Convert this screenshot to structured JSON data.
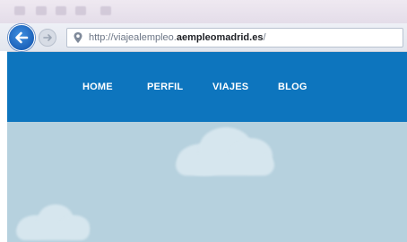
{
  "browser": {
    "address": {
      "url_prefix": "http://viajealempleo.",
      "url_domain": "aempleomadrid.es",
      "url_suffix": "/"
    },
    "icons": {
      "back": "back-arrow-icon",
      "forward": "forward-arrow-icon",
      "site": "page-icon"
    },
    "colors": {
      "back_button": "#1a5fb7"
    }
  },
  "site": {
    "nav": {
      "items": [
        {
          "label": "HOME"
        },
        {
          "label": "PERFIL"
        },
        {
          "label": "VIAJES"
        },
        {
          "label": "BLOG"
        }
      ]
    },
    "colors": {
      "nav_bg": "#0d75be",
      "sky_bg": "#b6d1de",
      "cloud": "#d6e6ee"
    }
  }
}
